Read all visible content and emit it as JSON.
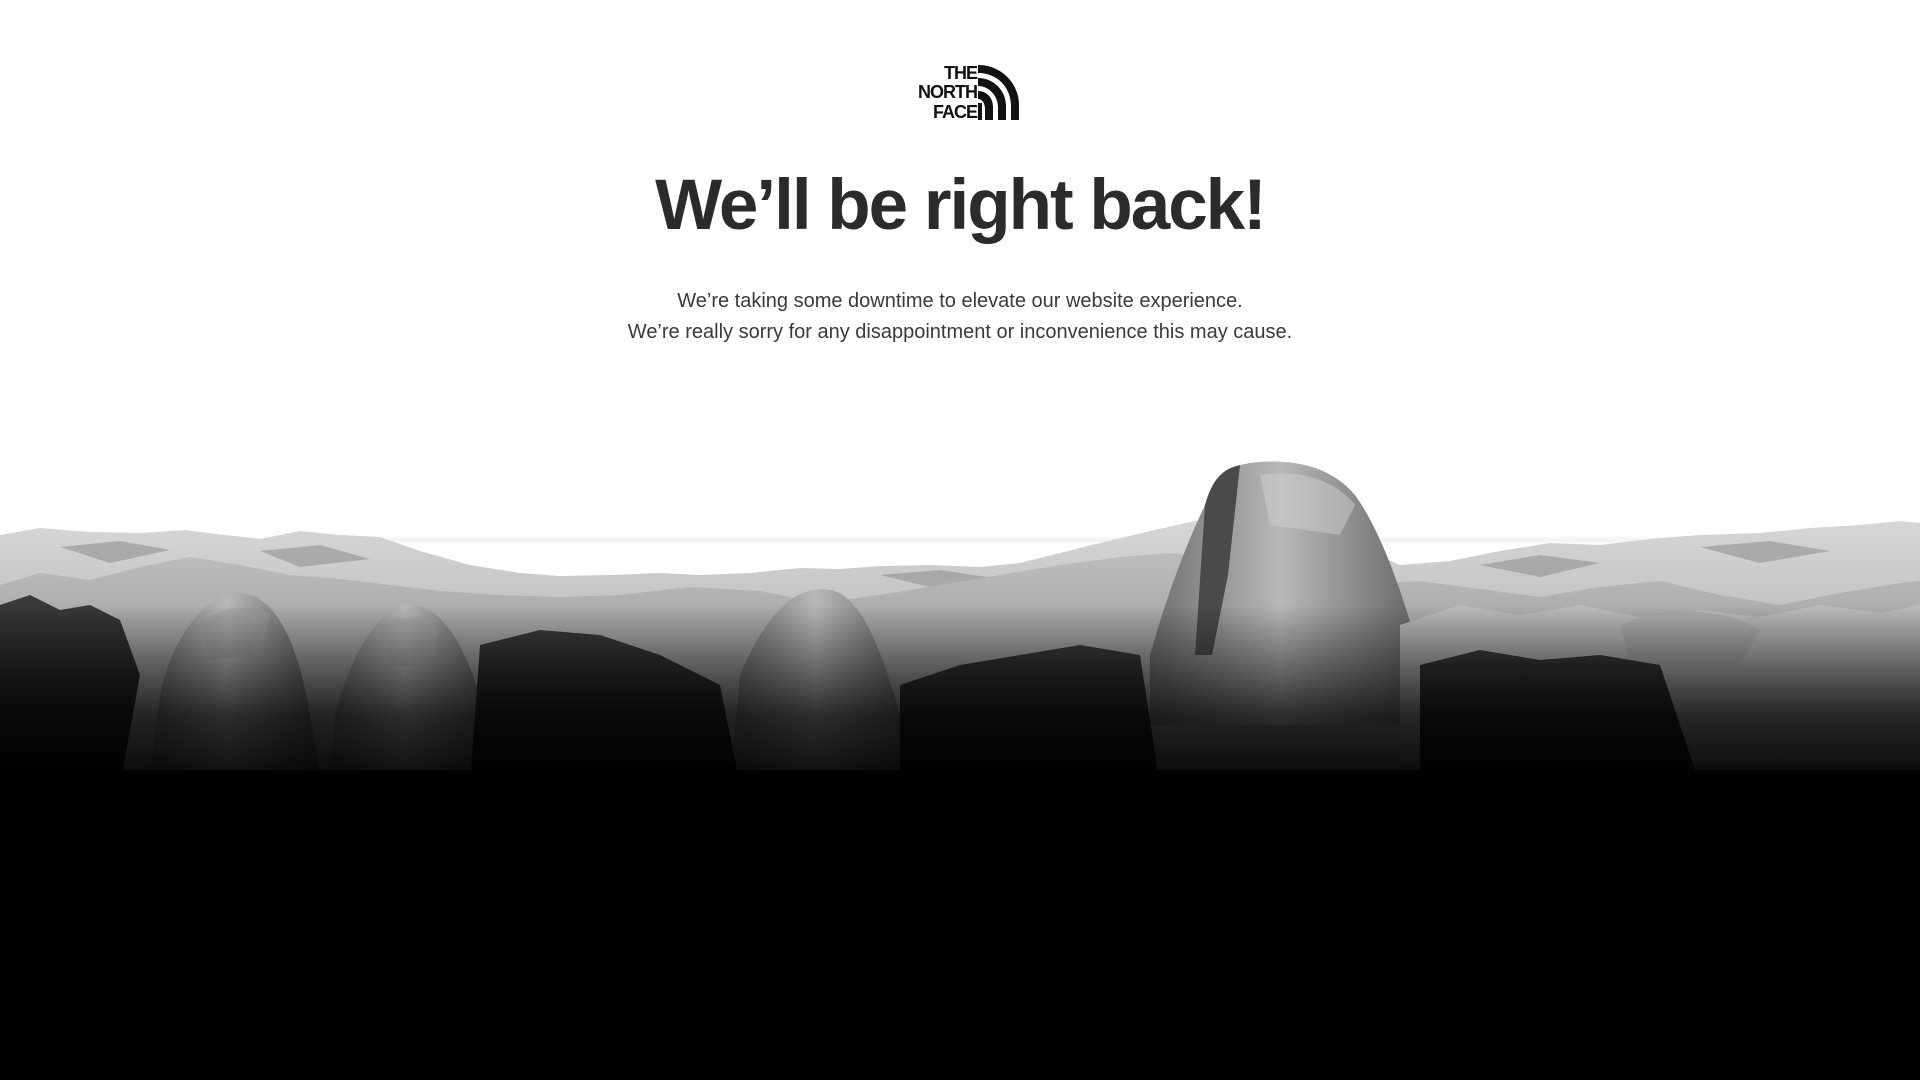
{
  "brand": {
    "logo_name": "the-north-face-logo",
    "logo_lines": [
      "THE",
      "NORTH",
      "FACE"
    ],
    "logo_color": "#111111"
  },
  "headline": "We’ll be right back!",
  "message": {
    "line1": "We’re taking some downtime to elevate our website experience.",
    "line2": "We’re really sorry for any disappointment or inconvenience this may cause."
  },
  "colors": {
    "background": "#ffffff",
    "headline": "#2b2b2b",
    "body_text": "#3a3a3a",
    "footer": "#000000"
  },
  "hero_image": {
    "name": "mountain-landscape-image",
    "style": "black-and-white mountain panorama fading to black"
  }
}
